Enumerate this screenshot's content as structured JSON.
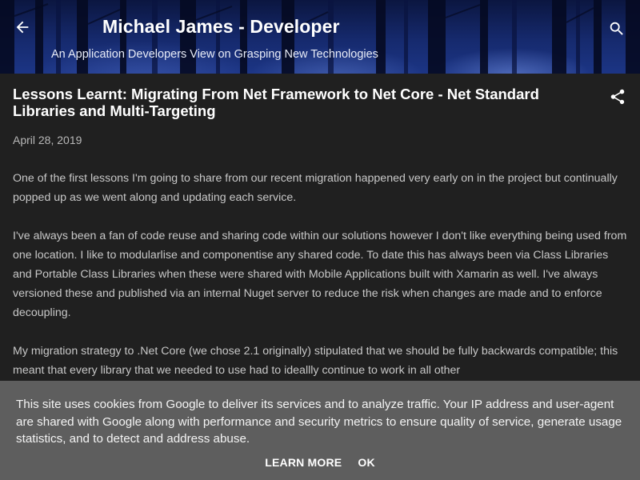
{
  "header": {
    "blog_title": "Michael James - Developer",
    "blog_description": "An Application Developers View on Grasping New Technologies",
    "back_icon": "arrow-left-icon",
    "search_icon": "search-icon"
  },
  "post": {
    "title": "Lessons Learnt: Migrating From Net Framework to Net Core - Net Standard Libraries and Multi-Targeting",
    "share_icon": "share-icon",
    "date": "April 28, 2019",
    "paragraphs": [
      "One of the first lessons I'm going to share from our recent migration happened very early on in the project but continually popped up as we went along and updating each service.",
      "I've always been a fan of code reuse and sharing code within our solutions however I don't like everything being used from one location. I like to modularlise and componentise any shared code. To date this has always been via Class Libraries and Portable Class Libraries when these were shared with Mobile Applications built with Xamarin as well. I've always versioned these and published via an internal Nuget server to reduce the risk when changes are made and to enforce decoupling.",
      "My migration strategy to .Net Core (we chose 2.1 originally) stipulated that we should be fully backwards compatible; this meant that every library that we needed to use had to ideallly continue to work in all other"
    ]
  },
  "cookie_banner": {
    "message": "This site uses cookies from Google to deliver its services and to analyze traffic. Your IP address and user-agent are shared with Google along with performance and security metrics to ensure quality of service, generate usage statistics, and to detect and address abuse.",
    "learn_more_label": "Learn more",
    "ok_label": "OK"
  },
  "colors": {
    "background": "#202020",
    "header_blue": "#162a6e",
    "cookie_banner": "#5e5e5e",
    "body_text": "#c8c8c8"
  }
}
